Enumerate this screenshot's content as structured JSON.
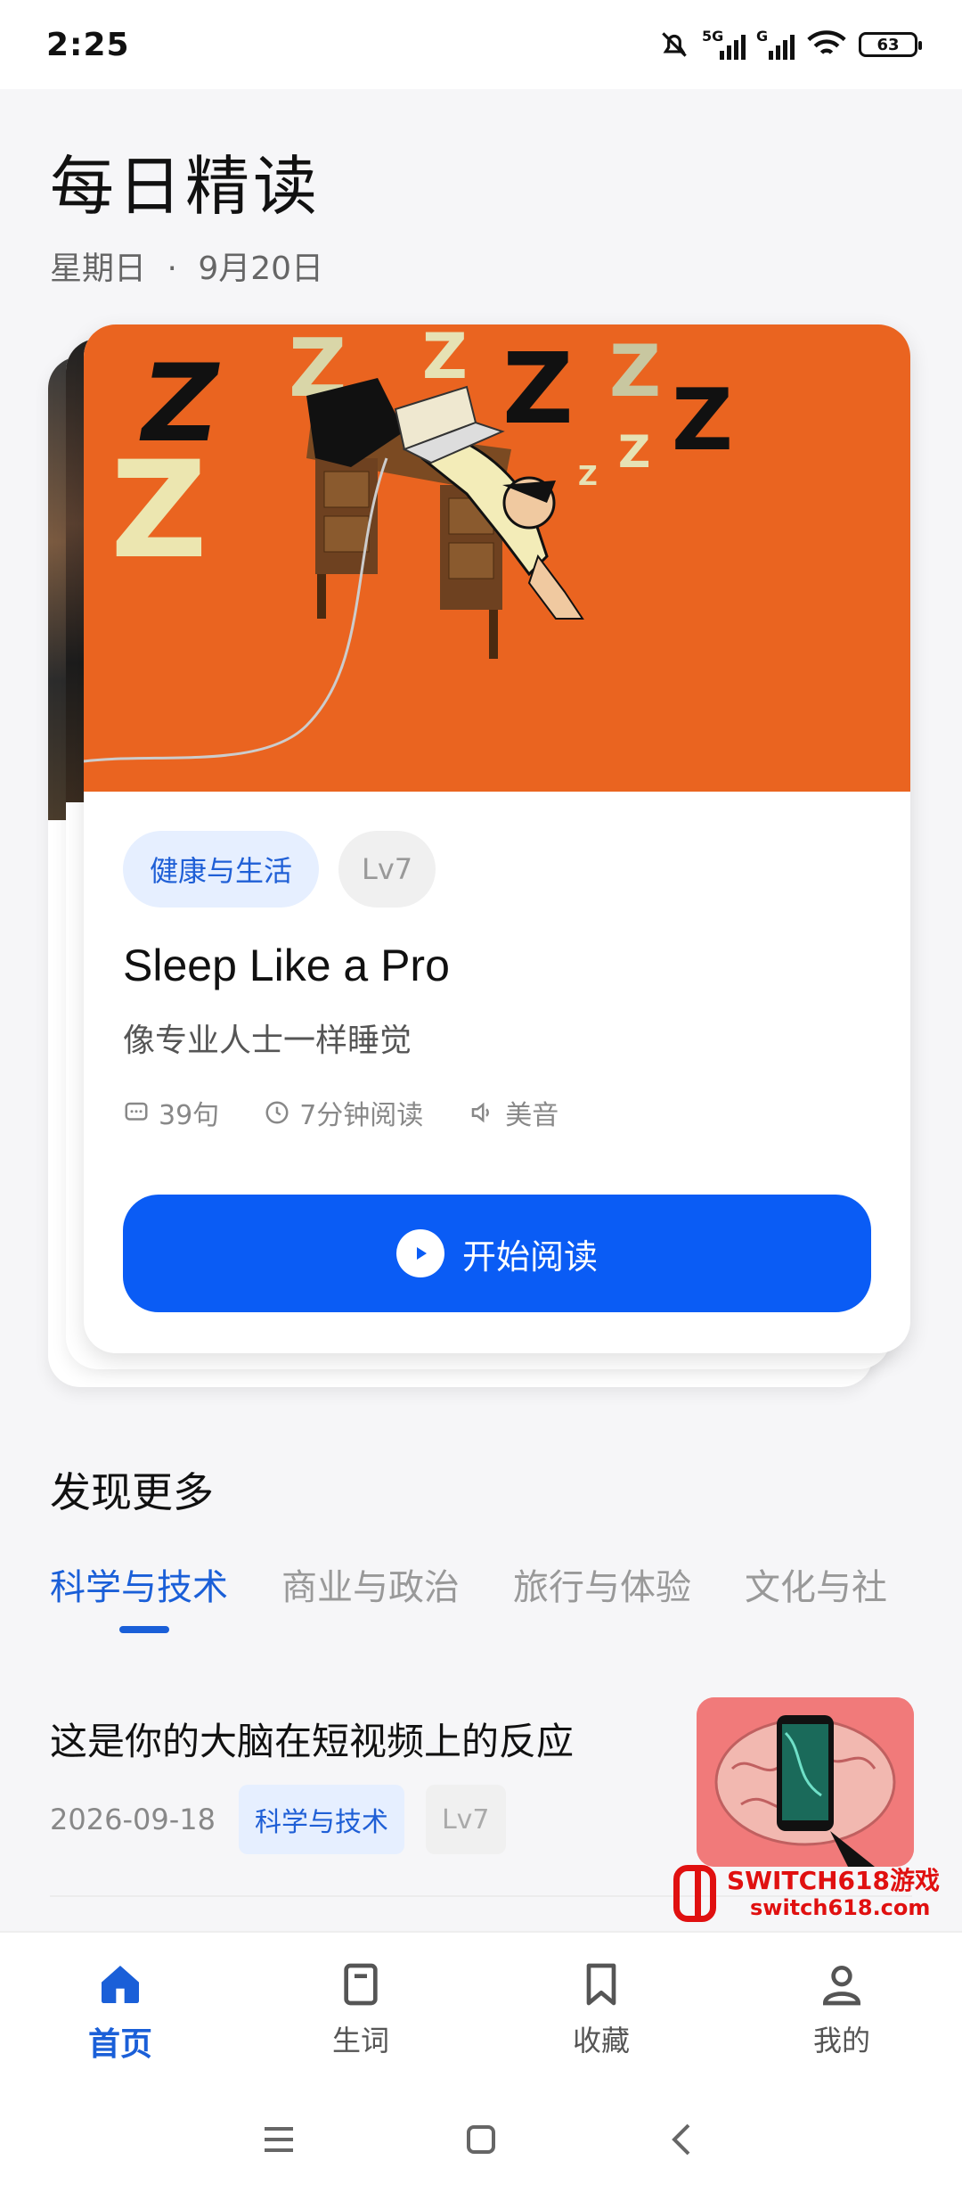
{
  "status_bar": {
    "time": "2:25",
    "network_1": "5G",
    "network_2": "G",
    "battery": "63"
  },
  "header": {
    "title": "每日精读",
    "date_weekday": "星期日",
    "date_separator": "·",
    "date_day": "9月20日"
  },
  "featured": {
    "category": "健康与生活",
    "level": "Lv7",
    "title": "Sleep Like a Pro",
    "subtitle": "像专业人士一样睡觉",
    "sentences": "39句",
    "read_time": "7分钟阅读",
    "accent": "美音",
    "start_label": "开始阅读",
    "hero_color": "#ea6420"
  },
  "discover": {
    "title": "发现更多",
    "tabs": [
      "科学与技术",
      "商业与政治",
      "旅行与体验",
      "文化与社"
    ],
    "active_tab": 0,
    "articles": [
      {
        "title": "这是你的大脑在短视频上的反应",
        "date": "2026-09-18",
        "category": "科学与技术",
        "level": "Lv7"
      }
    ]
  },
  "watermark": {
    "brand": "SWITCH618游戏",
    "url": "switch618.com"
  },
  "bottom_nav": [
    {
      "label": "首页",
      "icon": "home-icon",
      "active": true
    },
    {
      "label": "生词",
      "icon": "vocab-book-icon",
      "active": false
    },
    {
      "label": "收藏",
      "icon": "bookmark-icon",
      "active": false
    },
    {
      "label": "我的",
      "icon": "profile-icon",
      "active": false
    }
  ],
  "colors": {
    "primary": "#0a5cf5",
    "tab_active": "#1a5fd8",
    "tag_bg": "#e6efff"
  }
}
